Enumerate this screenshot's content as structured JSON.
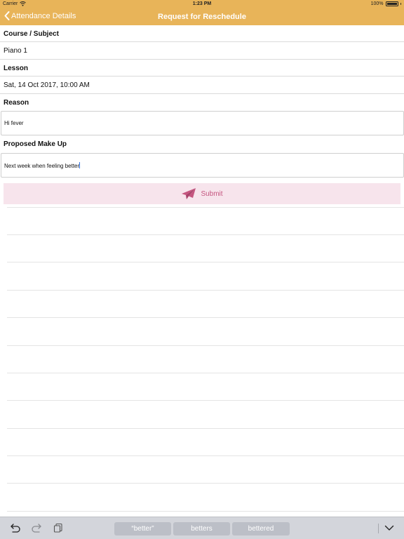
{
  "status_bar": {
    "carrier": "Carrier",
    "time": "1:23 PM",
    "battery": "100%",
    "battery_level": 1.0
  },
  "nav": {
    "back_label": "Attendance Details",
    "title": "Request for Reschedule"
  },
  "form": {
    "course_label": "Course / Subject",
    "course_value": "Piano 1",
    "lesson_label": "Lesson",
    "lesson_value": "Sat, 14 Oct 2017, 10:00 AM",
    "reason_label": "Reason",
    "reason_value": "Hi fever",
    "makeup_label": "Proposed Make Up",
    "makeup_value": "Next week when feeling better"
  },
  "submit": {
    "label": "Submit"
  },
  "keyboard_bar": {
    "suggestions": [
      "“better”",
      "betters",
      "bettered"
    ]
  },
  "colors": {
    "accent": "#e8b459",
    "submit_bg": "#f7e4ec",
    "submit_text": "#c5557f"
  },
  "icons": [
    "wifi-icon",
    "chevron-left-icon",
    "paper-plane-icon",
    "undo-icon",
    "redo-icon",
    "paste-icon",
    "chevron-down-icon"
  ]
}
